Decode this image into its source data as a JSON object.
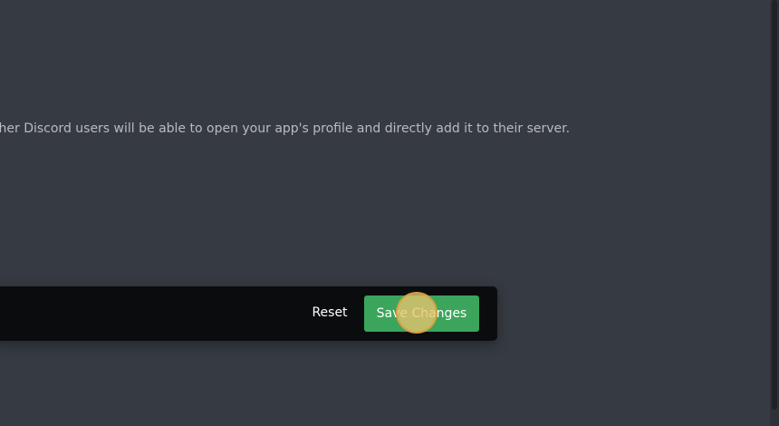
{
  "content": {
    "description": "Other Discord users will be able to open your app's profile and directly add it to their server."
  },
  "save_bar": {
    "reset_label": "Reset",
    "save_label": "Save Changes"
  },
  "colors": {
    "background": "#363a42",
    "bar_background": "#0b0c0d",
    "save_button": "#3ba55c",
    "text_muted": "#b9bbbe"
  }
}
